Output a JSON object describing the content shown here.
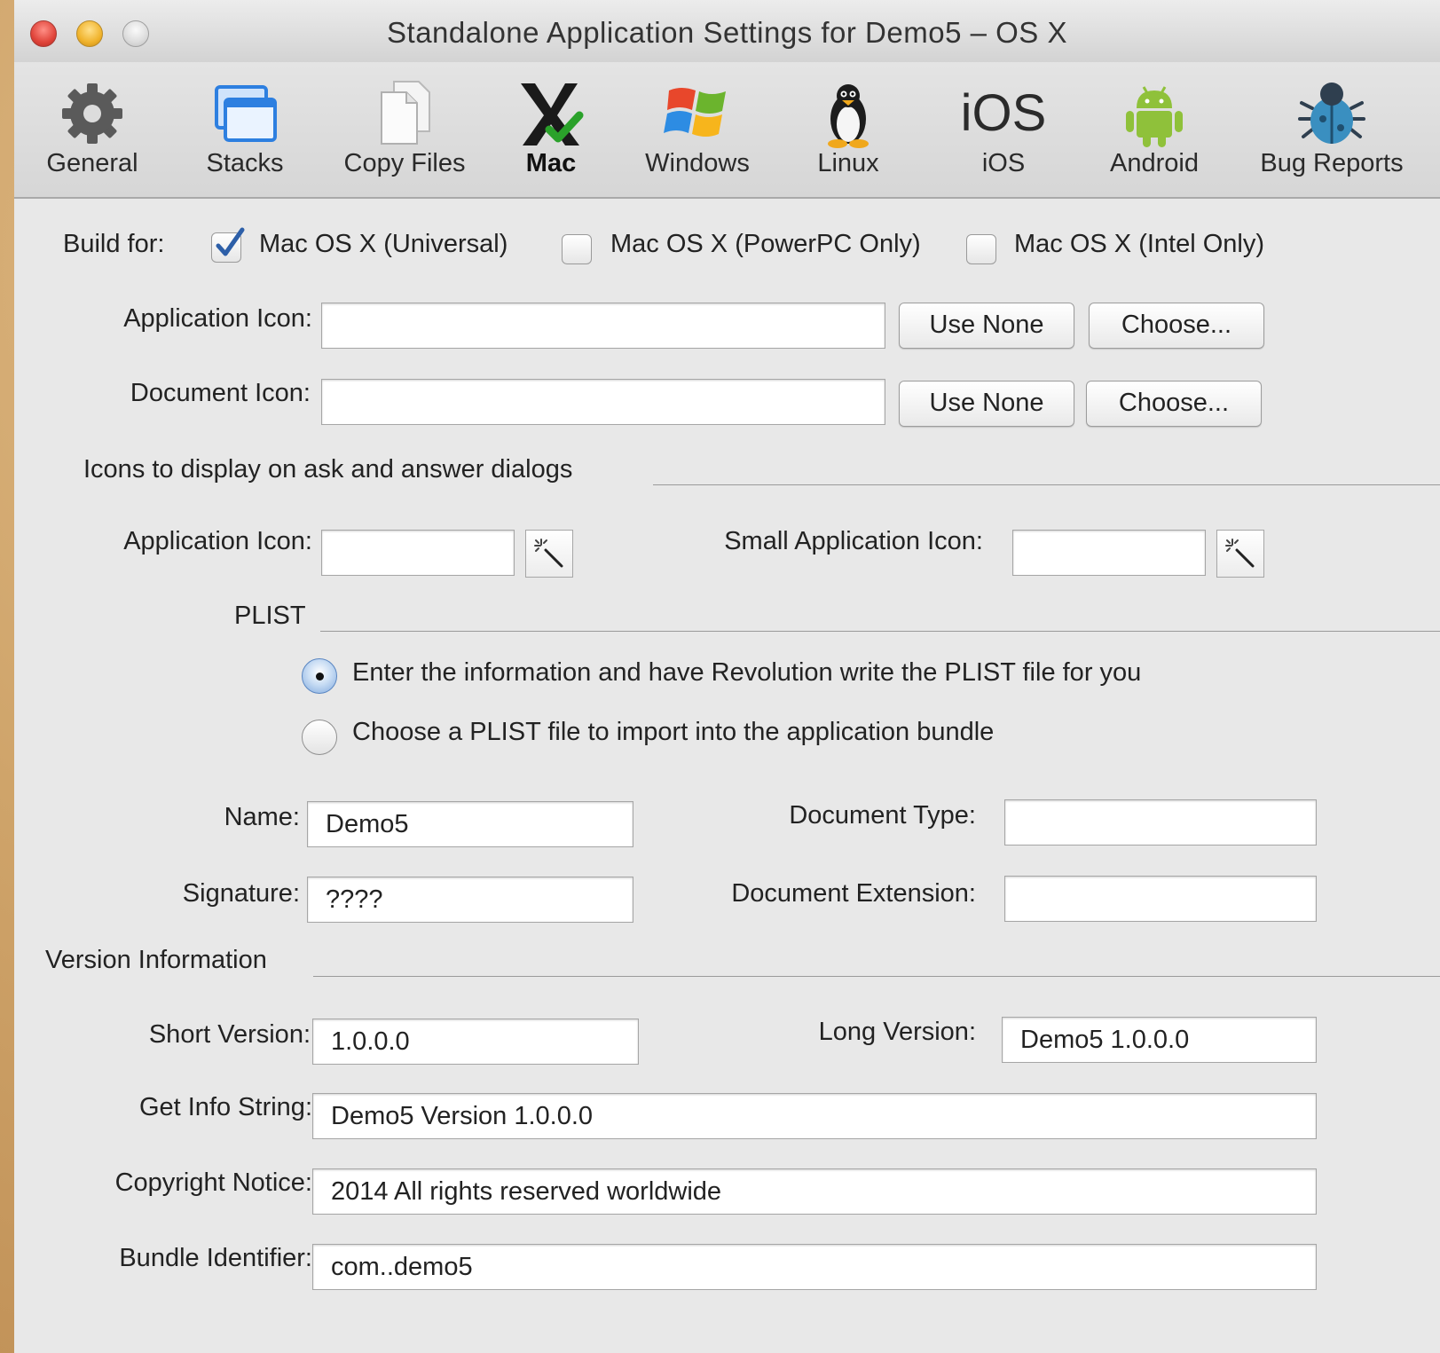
{
  "window": {
    "title": "Standalone Application Settings for Demo5 – OS X"
  },
  "toolbar": {
    "general": "General",
    "stacks": "Stacks",
    "copy_files": "Copy Files",
    "mac": "Mac",
    "windows": "Windows",
    "linux": "Linux",
    "ios": "iOS",
    "ios_logo_text": "iOS",
    "android": "Android",
    "bug_reports": "Bug Reports",
    "active": "Mac"
  },
  "build_for": {
    "label": "Build for:",
    "universal": "Mac OS X (Universal)",
    "universal_checked": true,
    "powerpc": "Mac OS X (PowerPC Only)",
    "powerpc_checked": false,
    "intel": "Mac OS X (Intel Only)",
    "intel_checked": false
  },
  "icons": {
    "app_icon_label": "Application Icon:",
    "app_icon_value": "",
    "doc_icon_label": "Document Icon:",
    "doc_icon_value": "",
    "use_none": "Use None",
    "choose": "Choose..."
  },
  "dialog_icons": {
    "section_title": "Icons to display on ask and answer dialogs",
    "app_icon_label": "Application Icon:",
    "app_icon_value": "",
    "small_icon_label": "Small Application Icon:",
    "small_icon_value": ""
  },
  "plist": {
    "section_title": "PLIST",
    "option_write": "Enter the information and have Revolution write the PLIST file for you",
    "option_import": "Choose a PLIST file to import into the application bundle",
    "selected": "write",
    "name_label": "Name:",
    "name_value": "Demo5",
    "signature_label": "Signature:",
    "signature_value": "????",
    "doc_type_label": "Document Type:",
    "doc_type_value": "",
    "doc_ext_label": "Document Extension:",
    "doc_ext_value": ""
  },
  "version": {
    "section_title": "Version Information",
    "short_label": "Short Version:",
    "short_value": "1.0.0.0",
    "long_label": "Long Version:",
    "long_value": "Demo5 1.0.0.0",
    "info_label": "Get Info String:",
    "info_value": "Demo5 Version 1.0.0.0",
    "copyright_label": "Copyright Notice:",
    "copyright_value": "2014  All rights reserved worldwide",
    "bundle_label": "Bundle Identifier:",
    "bundle_value": "com..demo5"
  },
  "colors": {
    "accent": "#3a6fc4",
    "window_bg": "#e8e8e8",
    "desktop": "#cfa46a"
  }
}
